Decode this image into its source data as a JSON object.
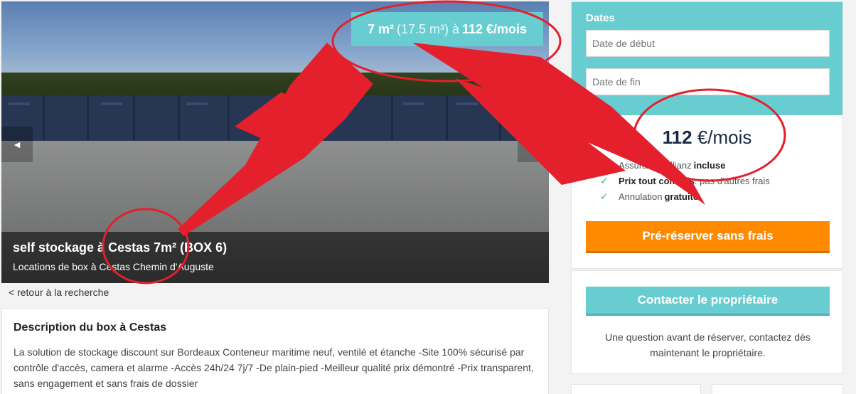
{
  "hero": {
    "badge": {
      "size": "7 m²",
      "volume": "(17.5 m³) à",
      "price": "112 €/mois"
    },
    "title": "self stockage à Cestas 7m² (BOX 6)",
    "subtitle": "Locations de box à Cestas Chemin d'Auguste",
    "prev_icon": "◄",
    "next_icon": "►"
  },
  "back_link": "< retour à la recherche",
  "description": {
    "title": "Description du box à Cestas",
    "text": "La solution de stockage discount sur Bordeaux Conteneur maritime neuf, ventilé et étanche -Site 100% sécurisé par contrôle d'accès, camera et alarme -Accès 24h/24 7j/7 -De plain-pied -Meilleur qualité prix démontré -Prix transparent, sans engagement et sans frais de dossier"
  },
  "booking": {
    "dates_label": "Dates",
    "start_placeholder": "Date de début",
    "end_placeholder": "Date de fin",
    "price_amount": "112",
    "price_unit": "€/mois",
    "features": [
      {
        "text": "Assurance Allianz ",
        "bold": "incluse"
      },
      {
        "text": "Prix tout compris",
        "bold": " : pas d'autres frais"
      },
      {
        "text": "Annulation ",
        "bold": "gratuite"
      }
    ],
    "prereserve_label": "Pré-réserver sans frais"
  },
  "contact": {
    "button_label": "Contacter le propriétaire",
    "text": "Une question avant de réserver, contactez dès maintenant le propriétaire."
  },
  "colors": {
    "accent": "#68cdd1",
    "cta": "#ff8a00",
    "annotation": "#e3202b"
  }
}
